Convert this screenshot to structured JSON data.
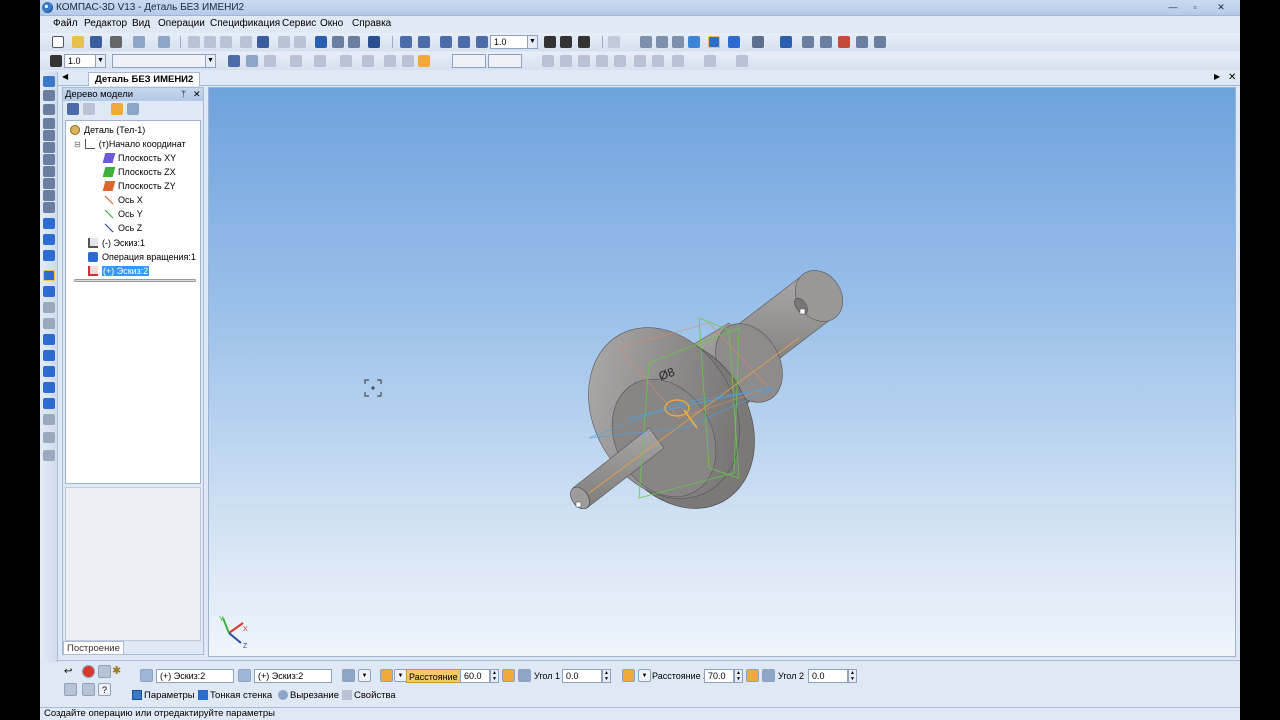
{
  "window": {
    "title": "КОМПАС-3D V13 - Деталь БЕЗ ИМЕНИ2",
    "controls": [
      "—",
      "▫",
      "✕"
    ]
  },
  "menu": [
    "Файл",
    "Редактор",
    "Вид",
    "Операции",
    "Спецификация",
    "Сервис",
    "Окно",
    "Справка"
  ],
  "toolbar": {
    "zoom_value": "1.0",
    "step_value": "1.0"
  },
  "doc_tab": {
    "label": "Деталь БЕЗ ИМЕНИ2"
  },
  "tree_panel": {
    "title": "Дерево модели",
    "pin": "ᛘ",
    "close": "✕",
    "bottom_tab": "Построение",
    "nodes": [
      {
        "label": "Деталь (Тел-1)",
        "icon": "part-icon"
      },
      {
        "label": "(т)Начало координат",
        "icon": "origin-icon"
      },
      {
        "label": "Плоскость XY",
        "icon": "plane-xy-icon"
      },
      {
        "label": "Плоскость ZX",
        "icon": "plane-zx-icon"
      },
      {
        "label": "Плоскость ZY",
        "icon": "plane-zy-icon"
      },
      {
        "label": "Ось X",
        "icon": "axis-x-icon"
      },
      {
        "label": "Ось Y",
        "icon": "axis-y-icon"
      },
      {
        "label": "Ось Z",
        "icon": "axis-z-icon"
      },
      {
        "label": "(-) Эскиз:1",
        "icon": "sketch-icon"
      },
      {
        "label": "Операция вращения:1",
        "icon": "revolve-icon"
      },
      {
        "label": "(+) Эскиз:2",
        "icon": "sketch-icon"
      }
    ]
  },
  "viewport": {
    "dimension_label": "Ø8",
    "axis_labels": {
      "x": "X",
      "y": "Y",
      "z": "Z"
    }
  },
  "properties": {
    "sketch1": "(+) Эскиз:2",
    "sketch2": "(+) Эскиз:2",
    "distance1_label": "Расстояние 1",
    "distance1_value": "60.0",
    "angle1_label": "Угол 1",
    "angle1_value": "0.0",
    "distance2_label": "Расстояние 2",
    "distance2_value": "70.0",
    "angle2_label": "Угол 2",
    "angle2_value": "0.0",
    "tabs": [
      "Параметры",
      "Тонкая стенка",
      "Вырезание",
      "Свойства"
    ]
  },
  "status_text": "Создайте операцию или отредактируйте параметры",
  "colors": {
    "selection": "#3399ff",
    "highlight_field": "#f6c768",
    "viewport_top": "#6ea2dd",
    "viewport_bottom": "#f0f5fb"
  }
}
